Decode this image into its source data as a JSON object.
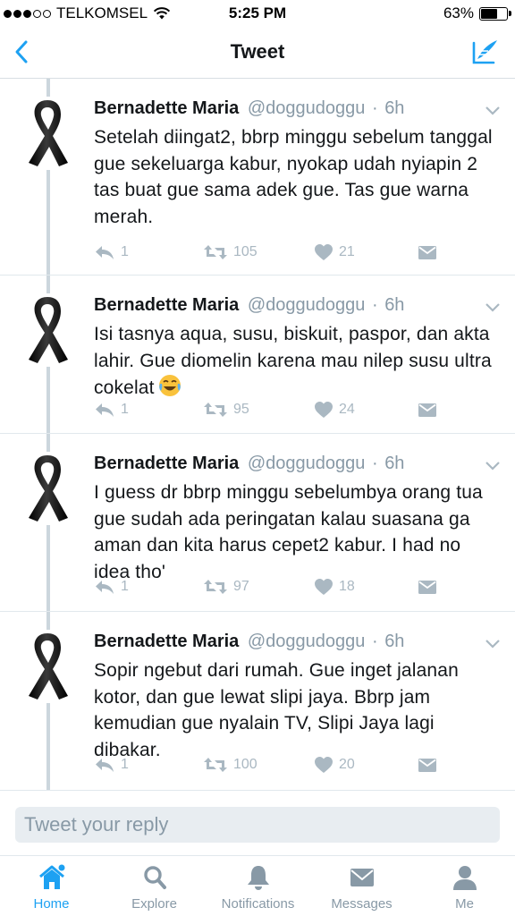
{
  "status_bar": {
    "carrier": "TELKOMSEL",
    "time": "5:25 PM",
    "battery": "63%",
    "battery_level": 0.63
  },
  "nav": {
    "title": "Tweet",
    "back_icon": "chevron-left-icon",
    "compose_icon": "compose-tweet-icon",
    "accent_color": "#1da1f2"
  },
  "tweets": [
    {
      "name": "Bernadette Maria",
      "handle": "@doggudoggu",
      "sep": "·",
      "time": "6h",
      "text": "Setelah diingat2, bbrp minggu sebelum tanggal gue sekeluarga kabur, nyokap udah nyiapin 2 tas buat gue sama adek gue. Tas gue warna merah.",
      "replies": "1",
      "retweets": "105",
      "likes": "21"
    },
    {
      "name": "Bernadette Maria",
      "handle": "@doggudoggu",
      "sep": "·",
      "time": "6h",
      "text": "Isi tasnya aqua, susu, biskuit, paspor, dan akta lahir. Gue diomelin karena mau nilep susu ultra cokelat",
      "replies": "1",
      "retweets": "95",
      "likes": "24"
    },
    {
      "name": "Bernadette Maria",
      "handle": "@doggudoggu",
      "sep": "·",
      "time": "6h",
      "text": "I guess dr bbrp minggu sebelumbya orang tua gue sudah ada peringatan kalau suasana ga aman dan kita harus cepet2 kabur. I had no idea tho'",
      "replies": "1",
      "retweets": "97",
      "likes": "18"
    },
    {
      "name": "Bernadette Maria",
      "handle": "@doggudoggu",
      "sep": "·",
      "time": "6h",
      "text": "Sopir ngebut dari rumah. Gue inget jalanan kotor, dan gue lewat slipi jaya. Bbrp jam kemudian gue nyalain TV, Slipi Jaya lagi dibakar.",
      "replies": "1",
      "retweets": "100",
      "likes": "20"
    }
  ],
  "reply": {
    "placeholder": "Tweet your reply"
  },
  "tabs": [
    {
      "label": "Home",
      "icon": "home-icon",
      "active": true
    },
    {
      "label": "Explore",
      "icon": "search-icon",
      "active": false
    },
    {
      "label": "Notifications",
      "icon": "bell-icon",
      "active": false
    },
    {
      "label": "Messages",
      "icon": "envelope-icon",
      "active": false
    },
    {
      "label": "Me",
      "icon": "person-icon",
      "active": false
    }
  ]
}
